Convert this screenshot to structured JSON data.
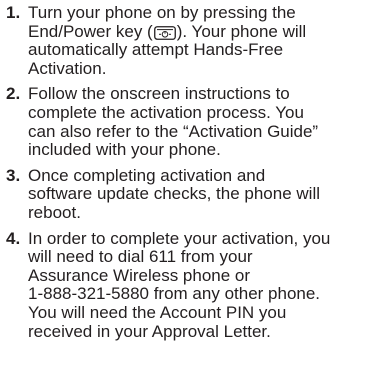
{
  "steps": [
    {
      "number": "1.",
      "lines": [
        "Turn your phone on by pressing the",
        "End/Power key (",
        "). Your phone will",
        "automatically attempt Hands-Free",
        "Activation."
      ],
      "icon": "end-power-key-icon"
    },
    {
      "number": "2.",
      "lines": [
        "Follow the onscreen instructions to",
        "complete the activation process. You",
        "can also refer to the “Activation Guide”",
        "included with your phone."
      ]
    },
    {
      "number": "3.",
      "lines": [
        "Once completing activation and",
        "software update checks, the phone will",
        "reboot."
      ]
    },
    {
      "number": "4.",
      "lines": [
        "In order to complete your activation, you",
        "will need to dial 611 from your",
        "Assurance Wireless phone or",
        "1-888-321-5880 from any other phone.",
        "You will need the Account PIN you",
        "received in your Approval Letter."
      ]
    }
  ]
}
